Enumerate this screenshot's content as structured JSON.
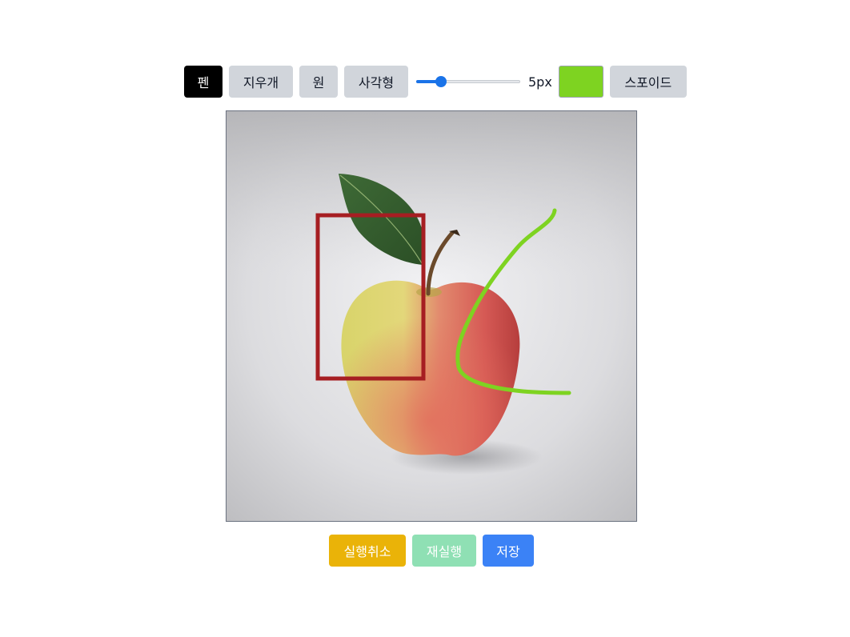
{
  "toolbar": {
    "pen_label": "펜",
    "eraser_label": "지우개",
    "circle_label": "원",
    "rect_label": "사각형",
    "brush_size_value": 5,
    "brush_size_label": "5px",
    "current_color": "#7ed321",
    "eyedropper_label": "스포이드"
  },
  "canvas": {
    "image_subject": "apple",
    "stroke_colors": {
      "rectangle": "#a61e22",
      "pen_stroke": "#7ed321"
    }
  },
  "actions": {
    "undo_label": "실행취소",
    "redo_label": "재실행",
    "save_label": "저장"
  },
  "colors": {
    "active_tool_bg": "#000000",
    "tool_bg": "#d1d5db",
    "undo_bg": "#eab308",
    "redo_bg": "#8fe0b4",
    "save_bg": "#3b82f6",
    "slider_accent": "#1a73e8"
  }
}
